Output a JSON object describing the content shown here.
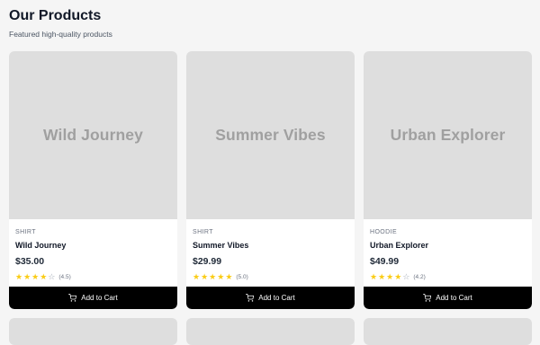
{
  "header": {
    "title": "Our Products",
    "subtitle": "Featured high-quality products"
  },
  "products": [
    {
      "image_text": "Wild Journey",
      "category": "SHIRT",
      "name": "Wild Journey",
      "price": "$35.00",
      "rating": 4,
      "rating_label": "(4.5)",
      "button_label": "Add to Cart"
    },
    {
      "image_text": "Summer Vibes",
      "category": "SHIRT",
      "name": "Summer Vibes",
      "price": "$29.99",
      "rating": 5,
      "rating_label": "(5.0)",
      "button_label": "Add to Cart"
    },
    {
      "image_text": "Urban Explorer",
      "category": "HOODIE",
      "name": "Urban Explorer",
      "price": "$49.99",
      "rating": 4,
      "rating_label": "(4.2)",
      "button_label": "Add to Cart"
    }
  ],
  "colors": {
    "star_filled": "#facc15",
    "star_empty": "#9ca3af",
    "button_bg": "#000000",
    "image_placeholder": "#dedede"
  },
  "icons": {
    "cart": "shopping-cart-icon",
    "star": "star-icon"
  }
}
